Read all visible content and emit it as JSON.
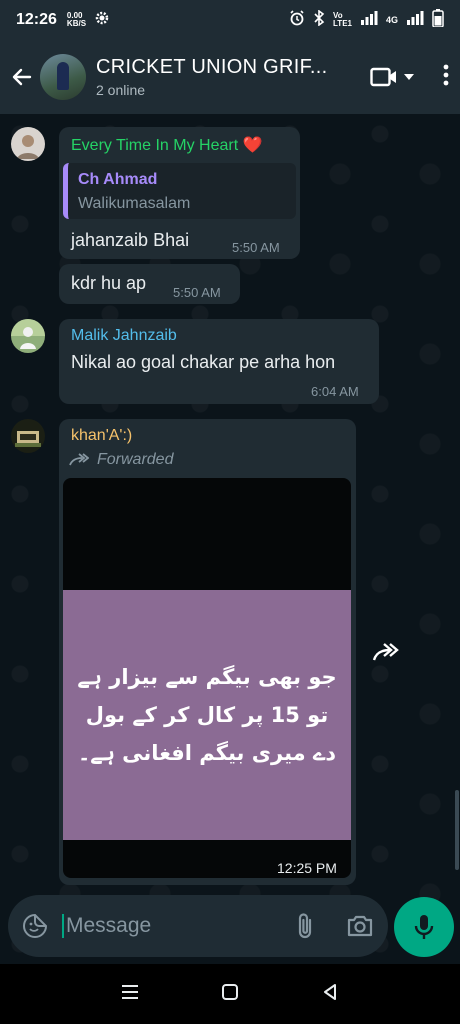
{
  "status_bar": {
    "time": "12:26",
    "speed_top": "0.00",
    "speed_bottom": "KB/S",
    "volte_top": "Vo",
    "volte_bottom": "LTE1",
    "network": "4G"
  },
  "header": {
    "title": "CRICKET UNION GRIF...",
    "subtitle": "2 online"
  },
  "messages": [
    {
      "sender": "Every Time In My Heart ❤️",
      "sender_color": "#25d366",
      "quote": {
        "name": "Ch Ahmad",
        "text": "Walikumasalam"
      },
      "text": "jahanzaib Bhai",
      "time": "5:50 AM"
    },
    {
      "text": "kdr hu ap",
      "time": "5:50 AM"
    },
    {
      "sender": "Malik Jahnzaib",
      "sender_color": "#53bdeb",
      "text": "Nikal ao goal chakar pe arha hon",
      "time": "6:04 AM"
    },
    {
      "sender": "khan'A':)",
      "sender_color": "#f5c26b",
      "forwarded": "Forwarded",
      "image_text": "جو بھی بیگم سے بیزار ہے تو 15 پر کال کر کے بول دے میری بیگم افغانی ہے۔",
      "time": "12:25 PM"
    }
  ],
  "composer": {
    "placeholder": "Message"
  },
  "colors": {
    "accent": "#00a884",
    "bubble": "#202c33",
    "background": "#0b141a",
    "header": "#1f2c34"
  }
}
